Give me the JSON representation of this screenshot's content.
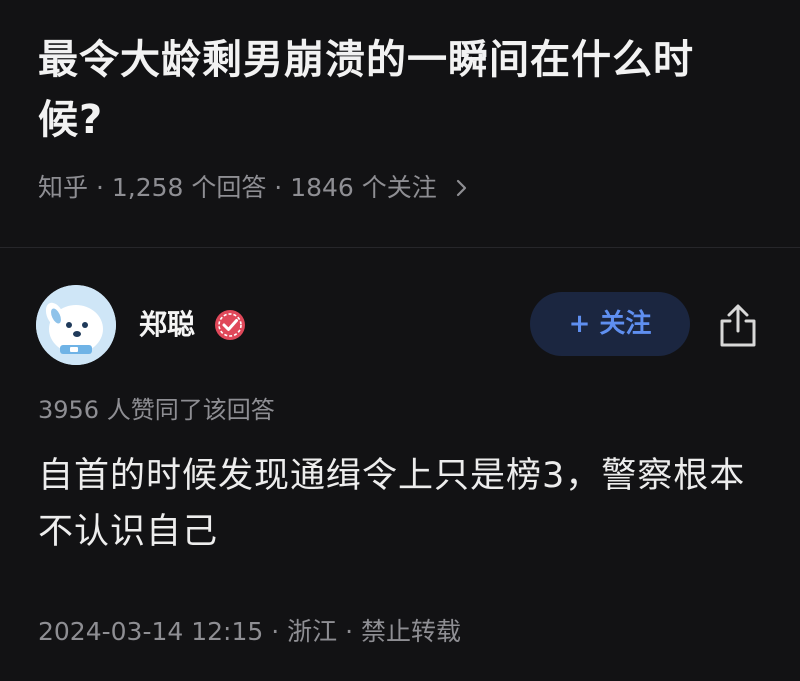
{
  "question": {
    "title": "最令大龄剩男崩溃的一瞬间在什么时候?",
    "meta": "知乎 · 1,258 个回答 · 1846 个关注"
  },
  "author": {
    "name": "郑聪",
    "follow_label": "+ 关注"
  },
  "answer": {
    "upvotes": "3956 人赞同了该回答",
    "body": "自首的时候发现通缉令上只是榜3，警察根本不认识自己",
    "footer": "2024-03-14 12:15 · 浙江 · 禁止转载"
  },
  "icons": {
    "chevron": "chevron-right-icon",
    "verified": "verified-badge-icon",
    "share": "share-icon"
  },
  "colors": {
    "background": "#121214",
    "accent": "#5f8ff0",
    "follow_bg": "#1b2640",
    "verified": "#e0485a",
    "muted_text": "#8e8e93"
  }
}
